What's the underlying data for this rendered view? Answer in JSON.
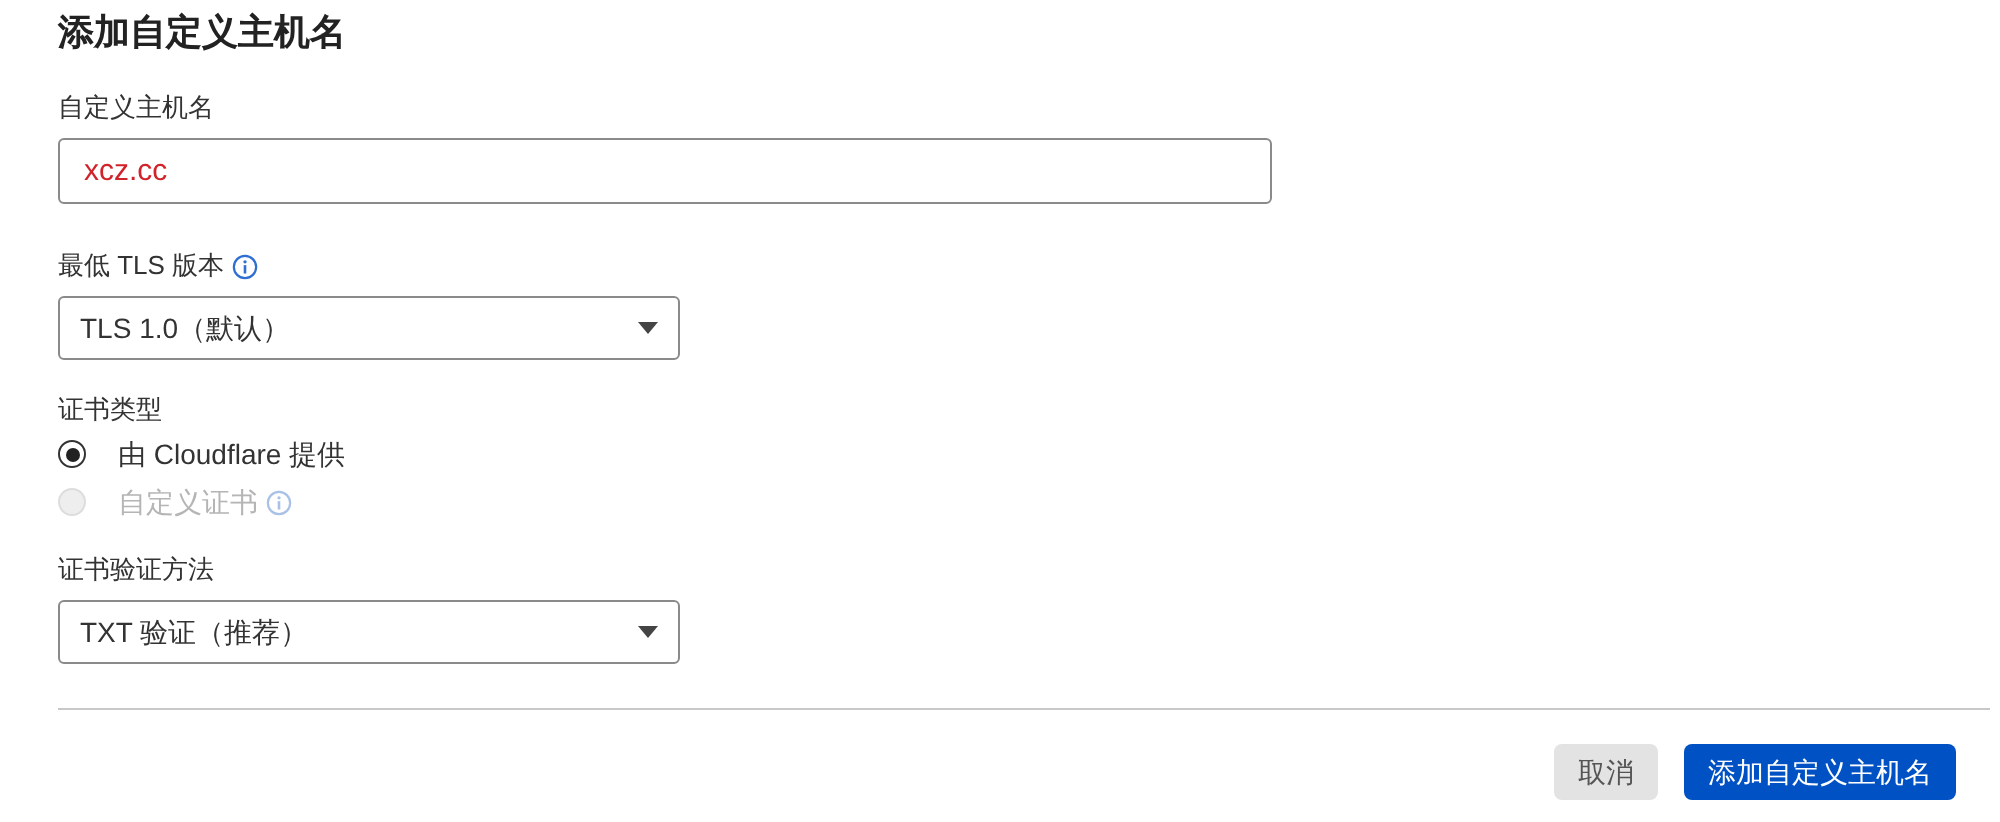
{
  "title": "添加自定义主机名",
  "hostname_field": {
    "label": "自定义主机名",
    "value": "xcz.cc"
  },
  "tls_select": {
    "label": "最低 TLS 版本",
    "value": "TLS 1.0（默认）"
  },
  "certificate_type": {
    "label": "证书类型",
    "options": [
      {
        "label": "由 Cloudflare 提供",
        "selected": true,
        "disabled": false,
        "info": false
      },
      {
        "label": "自定义证书",
        "selected": false,
        "disabled": true,
        "info": true
      }
    ]
  },
  "validation_select": {
    "label": "证书验证方法",
    "value": "TXT 验证（推荐）"
  },
  "buttons": [
    {
      "label": "取消",
      "kind": "secondary"
    },
    {
      "label": "添加自定义主机名",
      "kind": "primary"
    }
  ]
}
